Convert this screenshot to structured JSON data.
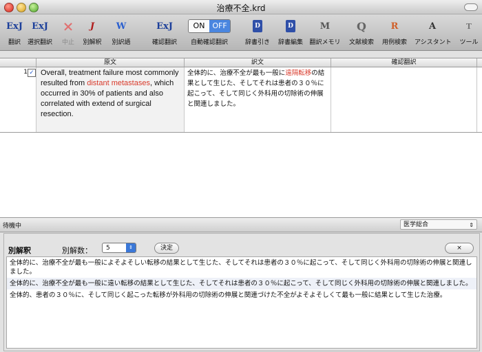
{
  "window": {
    "title": "治療不全.krd"
  },
  "toolbar": {
    "items": [
      {
        "label": "翻訳",
        "icon": "ExJ"
      },
      {
        "label": "選択翻訳",
        "icon": "ExJ"
      },
      {
        "label": "中止",
        "icon": "×"
      },
      {
        "label": "別解釈",
        "icon": "J"
      },
      {
        "label": "別訳語",
        "icon": "W"
      },
      {
        "label": "確認翻訳",
        "icon": "ExJ"
      },
      {
        "label": "自動確認翻訳",
        "on": "ON",
        "off": "OFF"
      },
      {
        "label": "辞書引き",
        "icon": "D"
      },
      {
        "label": "辞書編集",
        "icon": "D"
      },
      {
        "label": "翻訳メモリ",
        "icon": "M"
      },
      {
        "label": "文献検索",
        "icon": "Q"
      },
      {
        "label": "用例検索",
        "icon": "R"
      },
      {
        "label": "アシスタント",
        "icon": "A"
      },
      {
        "label": "ツール",
        "icon": "T"
      }
    ]
  },
  "table": {
    "headers": {
      "source": "原文",
      "translation": "訳文",
      "check": "確認翻訳"
    },
    "rows": [
      {
        "number": "1",
        "checked": true,
        "source_before": "Overall, treatment failure most commonly resulted from ",
        "source_highlight": "distant metastases",
        "source_after": ", which occurred in 30% of patients and also correlated with extend of surgical resection.",
        "translation_before": "全体的に、治療不全が最も一般に",
        "translation_highlight": "遠隔転移",
        "translation_after": "の結果として生じた、そしてそれは患者の３０％に起こって、そして同じく外科用の切除術の伸展と関連しました。",
        "check": ""
      }
    ]
  },
  "status": {
    "text": "待機中",
    "domain": "医学総合"
  },
  "alternatives": {
    "heading": "別解釈",
    "count_label": "別解数：",
    "count_value": "5",
    "decide_label": "決定",
    "close_label": "×",
    "items": [
      "全体的に、治療不全が最も一般によそよそしい転移の結果として生じた、そしてそれは患者の３０％に起こって、そして同じく外科用の切除術の伸展と関連しました。",
      "全体的に、治療不全が最も一般に遠い転移の結果として生じた、そしてそれは患者の３０％に起こって、そして同じく外科用の切除術の伸展と関連しました。",
      "全体的、患者の３０％に、そして同じく起こった転移が外科用の切除術の伸展と関連づけた不全がよそよそしくて最も一般に結果として生じた治療。"
    ]
  },
  "colors": {
    "highlight": "#d8392a",
    "toggle_off": "#4a86e0"
  }
}
